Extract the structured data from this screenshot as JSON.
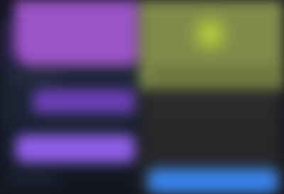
{
  "colors": {
    "background": "#15151f",
    "left_panel_purple": "#9a54c5",
    "left_mid_purple": "#6b3fb7",
    "left_primary_purple": "#8d5ee6",
    "right_olive": "#7f8c4a",
    "right_glow": "#c2d642",
    "right_dark": "#252526",
    "right_action_blue": "#3a82e8"
  }
}
